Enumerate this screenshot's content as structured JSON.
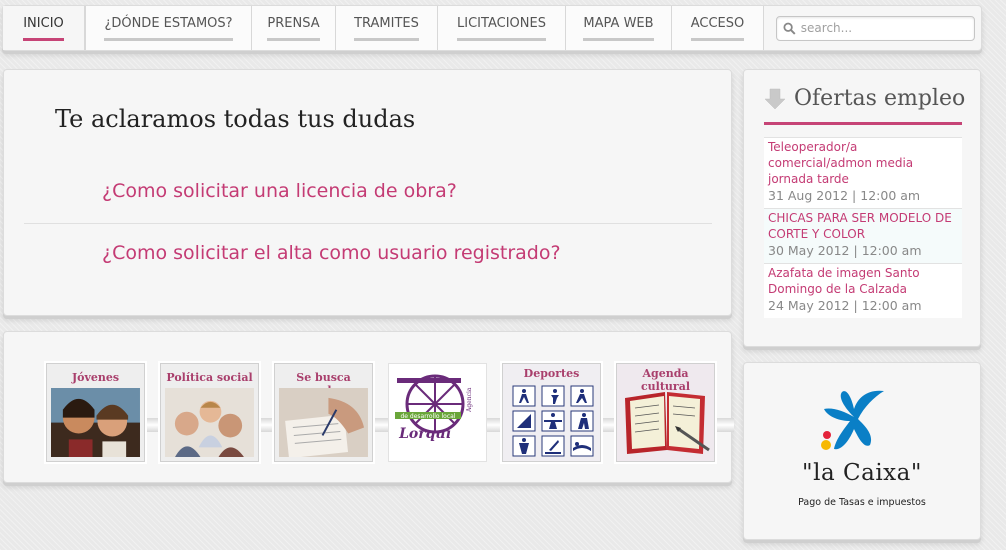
{
  "nav": {
    "items": [
      {
        "label": "INICIO",
        "active": true
      },
      {
        "label": "¿DÓNDE ESTAMOS?"
      },
      {
        "label": "PRENSA"
      },
      {
        "label": "TRAMITES"
      },
      {
        "label": "LICITACIONES"
      },
      {
        "label": "MAPA WEB"
      },
      {
        "label": "ACCESO"
      }
    ],
    "search_placeholder": "search..."
  },
  "faq": {
    "title": "Te aclaramos todas tus dudas",
    "links": [
      "¿Como solicitar una licencia de obra?",
      "¿Como solicitar el alta como usuario registrado?"
    ]
  },
  "banners": [
    {
      "label": "Jóvenes"
    },
    {
      "label": "Política social"
    },
    {
      "label": "Se busca empleo"
    },
    {
      "label": "Agencia de desarrollo local Lorquí"
    },
    {
      "label": "Deportes"
    },
    {
      "label": "Agenda cultural"
    }
  ],
  "ofertas": {
    "title": "Ofertas empleo",
    "jobs": [
      {
        "title": "Teleoperador/a comercial/admon media jornada tarde",
        "date": "31 Aug 2012",
        "time": "12:00 am"
      },
      {
        "title": "CHICAS PARA SER MODELO DE CORTE Y COLOR",
        "date": "30 May 2012",
        "time": "12:00 am"
      },
      {
        "title": "Azafata de imagen Santo Domingo de la Calzada",
        "date": "24 May 2012",
        "time": "12:00 am"
      }
    ]
  },
  "caixa": {
    "name": "\"la Caixa\"",
    "subtitle": "Pago de Tasas e impuestos"
  },
  "colors": {
    "accent": "#c64476",
    "link": "#c43b74",
    "caixa_blue": "#0a7fc6",
    "caixa_yellow": "#f7b800",
    "caixa_red": "#e4233b"
  }
}
